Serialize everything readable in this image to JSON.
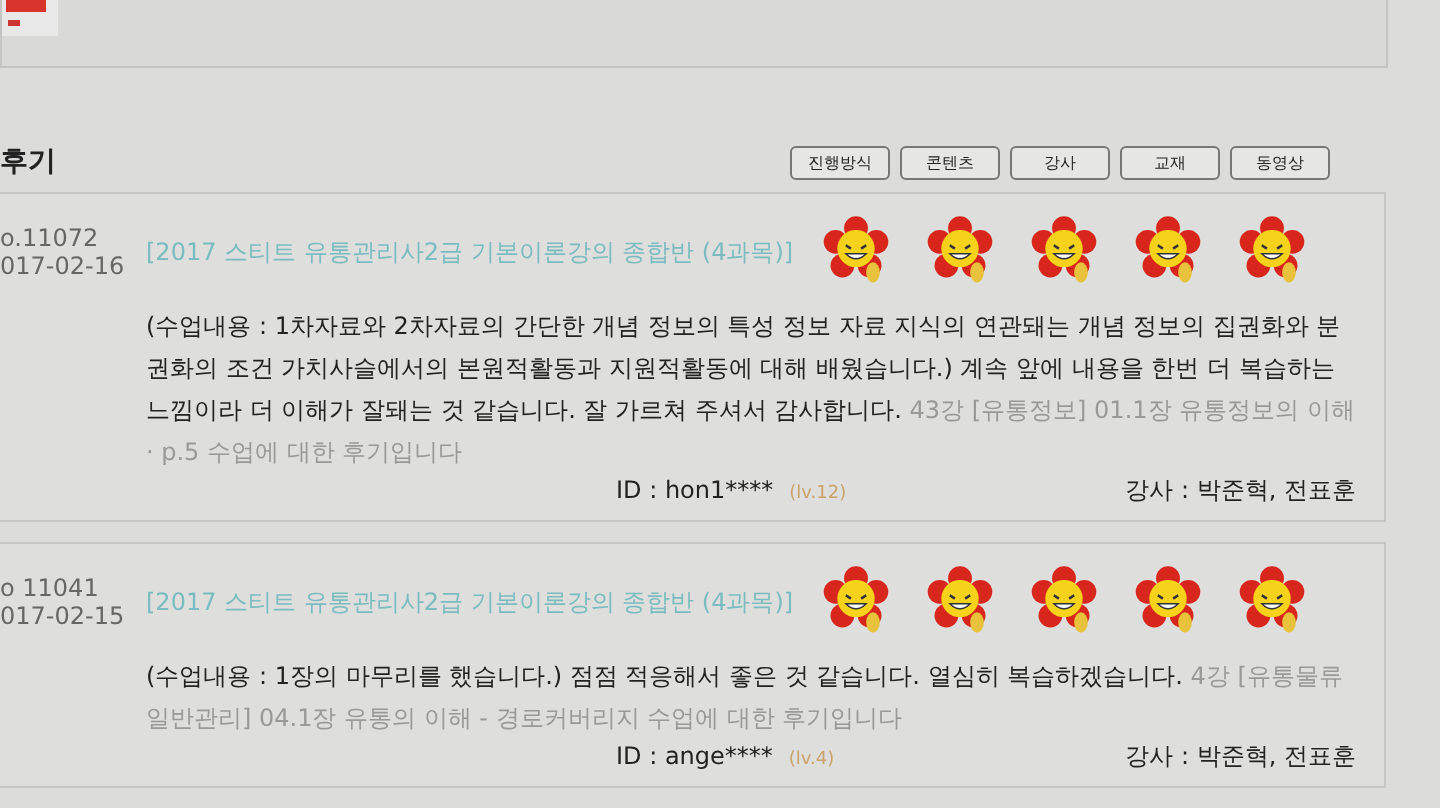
{
  "section_title": "후기",
  "filter_buttons": [
    "진행방식",
    "콘텐츠",
    "강사",
    "교재",
    "동영상"
  ],
  "reviews": [
    {
      "number": "o.11072",
      "date": "017-02-16",
      "course": "[2017 스티트 유통관리사2급 기본이론강의 종합반 (4과목)]",
      "stars": 5,
      "body": "(수업내용 : 1차자료와 2차자료의 간단한 개념 정보의 특성 정보 자료 지식의 연관돼는 개념 정보의 집권화와 분권화의 조건 가치사슬에서의 본원적활동과 지원적활동에 대해 배웠습니다.) 계속 앞에 내용을 한번 더 복습하는 느낌이라 더 이해가 잘돼는 것 같습니다. 잘 가르쳐 주셔서 감사합니다.",
      "note": "43강 [유통정보] 01.1장 유통정보의 이해 · p.5 수업에 대한 후기입니다",
      "user_id": "ID : hon1****",
      "level": "(lv.12)",
      "teacher": "강사 : 박준혁, 전표훈"
    },
    {
      "number": "o 11041",
      "date": "017-02-15",
      "course": "[2017 스티트 유통관리사2급 기본이론강의 종합반 (4과목)]",
      "stars": 5,
      "body": "(수업내용 : 1장의 마무리를 했습니다.) 점점 적응해서 좋은 것 같습니다. 열심히 복습하겠습니다.",
      "note": "4강 [유통물류일반관리] 04.1장 유통의 이해 - 경로커버리지 수업에 대한 후기입니다",
      "user_id": "ID : ange****",
      "level": "(lv.4)",
      "teacher": "강사 : 박준혁, 전표훈"
    }
  ]
}
